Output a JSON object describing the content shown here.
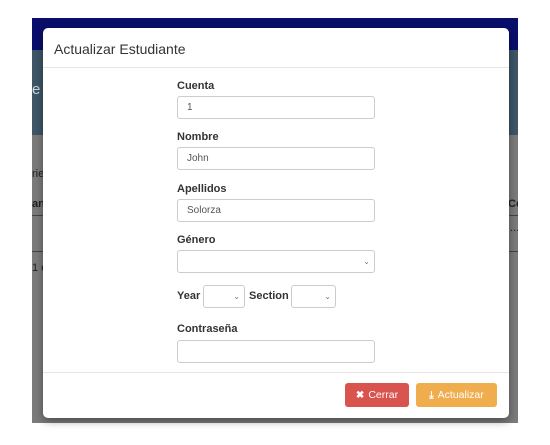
{
  "background": {
    "fragments": [
      "e",
      "rie",
      "an",
      "Co",
      "1 e",
      "..."
    ]
  },
  "modal": {
    "title": "Actualizar Estudiante",
    "fields": {
      "cuenta": {
        "label": "Cuenta",
        "value": "1"
      },
      "nombre": {
        "label": "Nombre",
        "value": "John"
      },
      "apellidos": {
        "label": "Apellidos",
        "value": "Solorza"
      },
      "genero": {
        "label": "Género",
        "value": ""
      },
      "year": {
        "label": "Year",
        "value": ""
      },
      "section": {
        "label": "Section",
        "value": ""
      },
      "contrasena": {
        "label": "Contraseña",
        "value": ""
      }
    },
    "footer": {
      "cerrar_label": "Cerrar",
      "actualizar_label": "Actualizar"
    }
  },
  "icons": {
    "close": "times-icon",
    "upload": "upload-icon",
    "caret": "chevron-down-icon"
  },
  "colors": {
    "navbar": "#0a0e6b",
    "danger": "#d9534f",
    "warning": "#f0ad4e"
  }
}
